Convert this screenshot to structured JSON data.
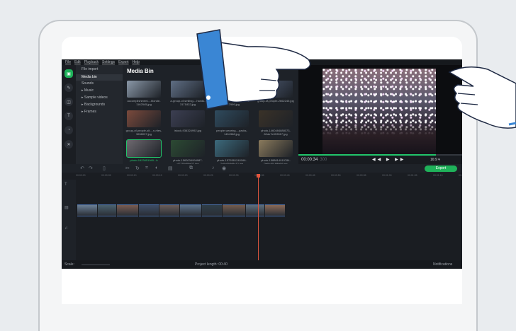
{
  "menu": [
    "File",
    "Edit",
    "Playback",
    "Settings",
    "Export",
    "Help"
  ],
  "tools": [
    {
      "icon": "media-import-icon",
      "glyph": "▣",
      "active": true
    },
    {
      "icon": "filters-icon",
      "glyph": "✎",
      "active": false
    },
    {
      "icon": "transitions-icon",
      "glyph": "◫",
      "active": false
    },
    {
      "icon": "titles-icon",
      "glyph": "T",
      "active": false
    },
    {
      "icon": "stickers-icon",
      "glyph": "◔",
      "active": false
    },
    {
      "icon": "more-tools-icon",
      "glyph": "✕",
      "active": false
    }
  ],
  "categories": [
    "File import",
    "Media bin",
    "Sounds",
    "▸ Music",
    "▸ Sample videos",
    "▸ Backgrounds",
    "▸ Frames"
  ],
  "media_bin": {
    "title": "Media Bin",
    "items": [
      {
        "caption": "accomplishment-...blonde-1162545.jpg",
        "color": "#8a98a8"
      },
      {
        "caption": "a-group-of-smiling-...hands-3171822.jpg",
        "color": "#5f6e84"
      },
      {
        "caption": "four-women-in-front-...ushes-1037999.jpg",
        "color": "#7c6a5a"
      },
      {
        "caption": "group-of-people-2662245.jpg",
        "color": "#4d5a72"
      },
      {
        "caption": "group-of-people-sit-...n-rites-3638097.jpg",
        "color": "#7b4a3c"
      },
      {
        "caption": "istock-936324992.jpg",
        "color": "#3c3f52"
      },
      {
        "caption": "people-wearing-...packs-1454368.jpg",
        "color": "#2f4b5e"
      },
      {
        "caption": "photo-1460484888073-80de7e053517.jpg",
        "color": "#3a3228"
      },
      {
        "caption": "photo-1623451940...b",
        "color": "#6e6a70",
        "selected": true
      },
      {
        "caption": "photo-1563034994987-d7778d09e27.jpg",
        "color": "#2c4a33"
      },
      {
        "caption": "photo-1579361240166-7c0c058d5c12.jpg",
        "color": "#3c6a7c"
      },
      {
        "caption": "photo-1588614919784-0e0c45188b94.jpg",
        "color": "#8a7a5c"
      }
    ]
  },
  "player": {
    "time": "00:00:34",
    "time_fraction": "300",
    "ratio": "16:9 ▾",
    "progress": 0.84,
    "controls": "◀◀ ▶ ▶▶"
  },
  "timeline": {
    "export_label": "Export",
    "ticks": [
      "00:00:00",
      "00:00:05",
      "00:00:10",
      "00:00:15",
      "00:00:20",
      "00:00:25",
      "00:00:30",
      "00:00:35",
      "00:00:40",
      "00:00:45",
      "00:00:50",
      "00:00:55",
      "00:01:00",
      "00:01:05",
      "00:01:10",
      "00:01:15"
    ],
    "clip_colors": [
      "#6a7f95",
      "#4b6270",
      "#7a5c52",
      "#3e4d66",
      "#6a5d5a",
      "#5a7088",
      "#2f3e48",
      "#735c4e",
      "#5e6e7c",
      "#8a6a58"
    ],
    "clip_widths": [
      28,
      26,
      30,
      28,
      28,
      30,
      28,
      32,
      26,
      28
    ]
  },
  "status": {
    "scale": "Scale:",
    "project_length": "Project length: 00:40",
    "notifications": "Notifications"
  },
  "colors": {
    "accent": "#1fb25a",
    "playhead": "#e3553d",
    "hand_cuff": "#3a86d4"
  }
}
